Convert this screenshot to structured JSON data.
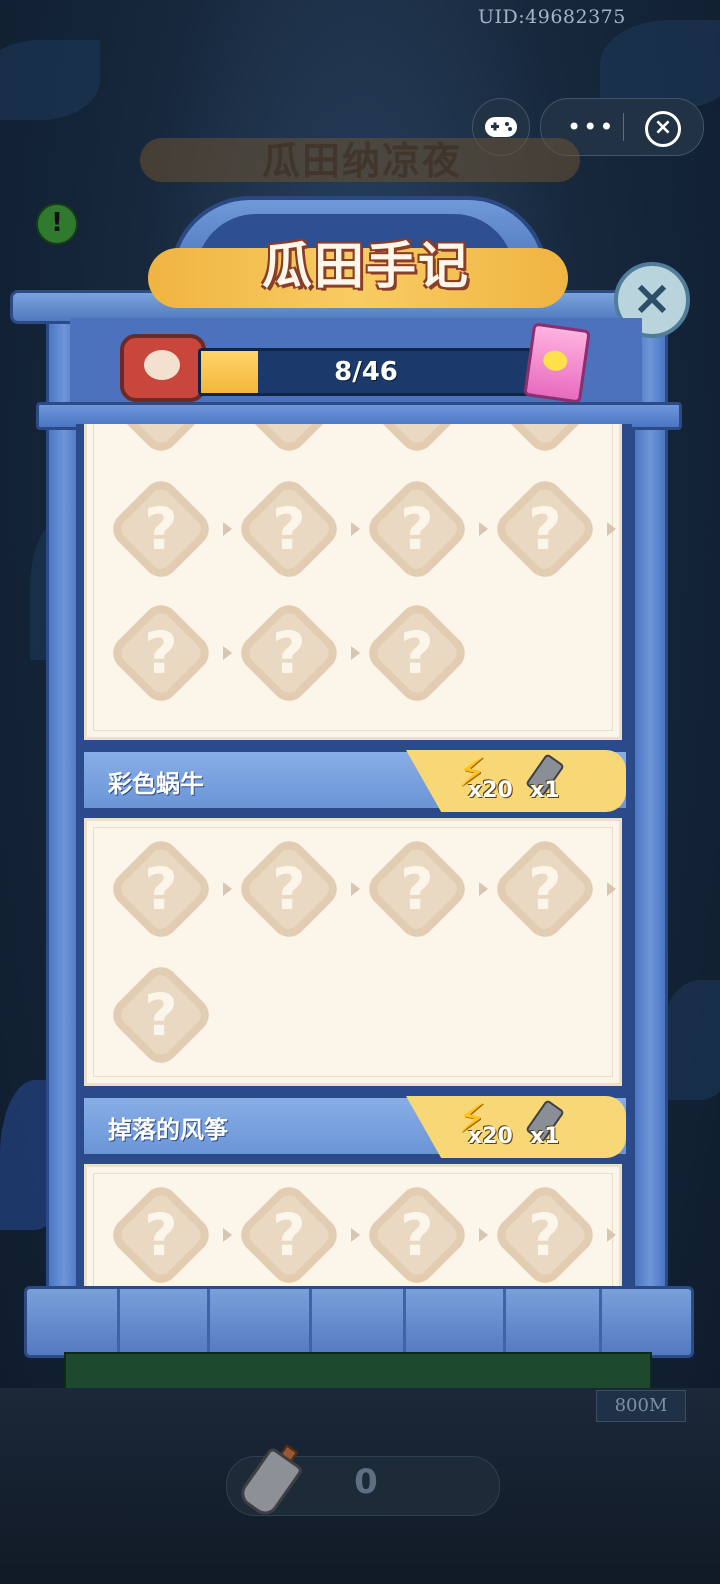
{
  "top_bar": {
    "uid": "UID:49682375",
    "icons": {
      "gamepad": "gamepad-icon",
      "more": "more-icon",
      "close": "close-circle-icon"
    },
    "more_glyph": "•••",
    "close_glyph": "×"
  },
  "event": {
    "title": "瓜田纳凉夜",
    "alert_glyph": "!"
  },
  "panel": {
    "title": "瓜田手记",
    "close_glyph": "×",
    "progress": {
      "text": "8/46",
      "current": 8,
      "total": 46
    }
  },
  "tile_placeholder": "?",
  "sections": [
    {
      "title": "",
      "tile_count": 7
    },
    {
      "title": "彩色蜗牛",
      "tile_count": 5,
      "reward": {
        "energy_qty": "x20",
        "shovel_qty": "x1"
      }
    },
    {
      "title": "掉落的风筝",
      "tile_count": 4,
      "reward": {
        "energy_qty": "x20",
        "shovel_qty": "x1"
      }
    }
  ],
  "footer": {
    "distance": "800M",
    "shovel_count": "0"
  },
  "colors": {
    "accent_blue": "#4c72bd",
    "gold": "#f3b63b",
    "paper": "#fcf5e9"
  }
}
